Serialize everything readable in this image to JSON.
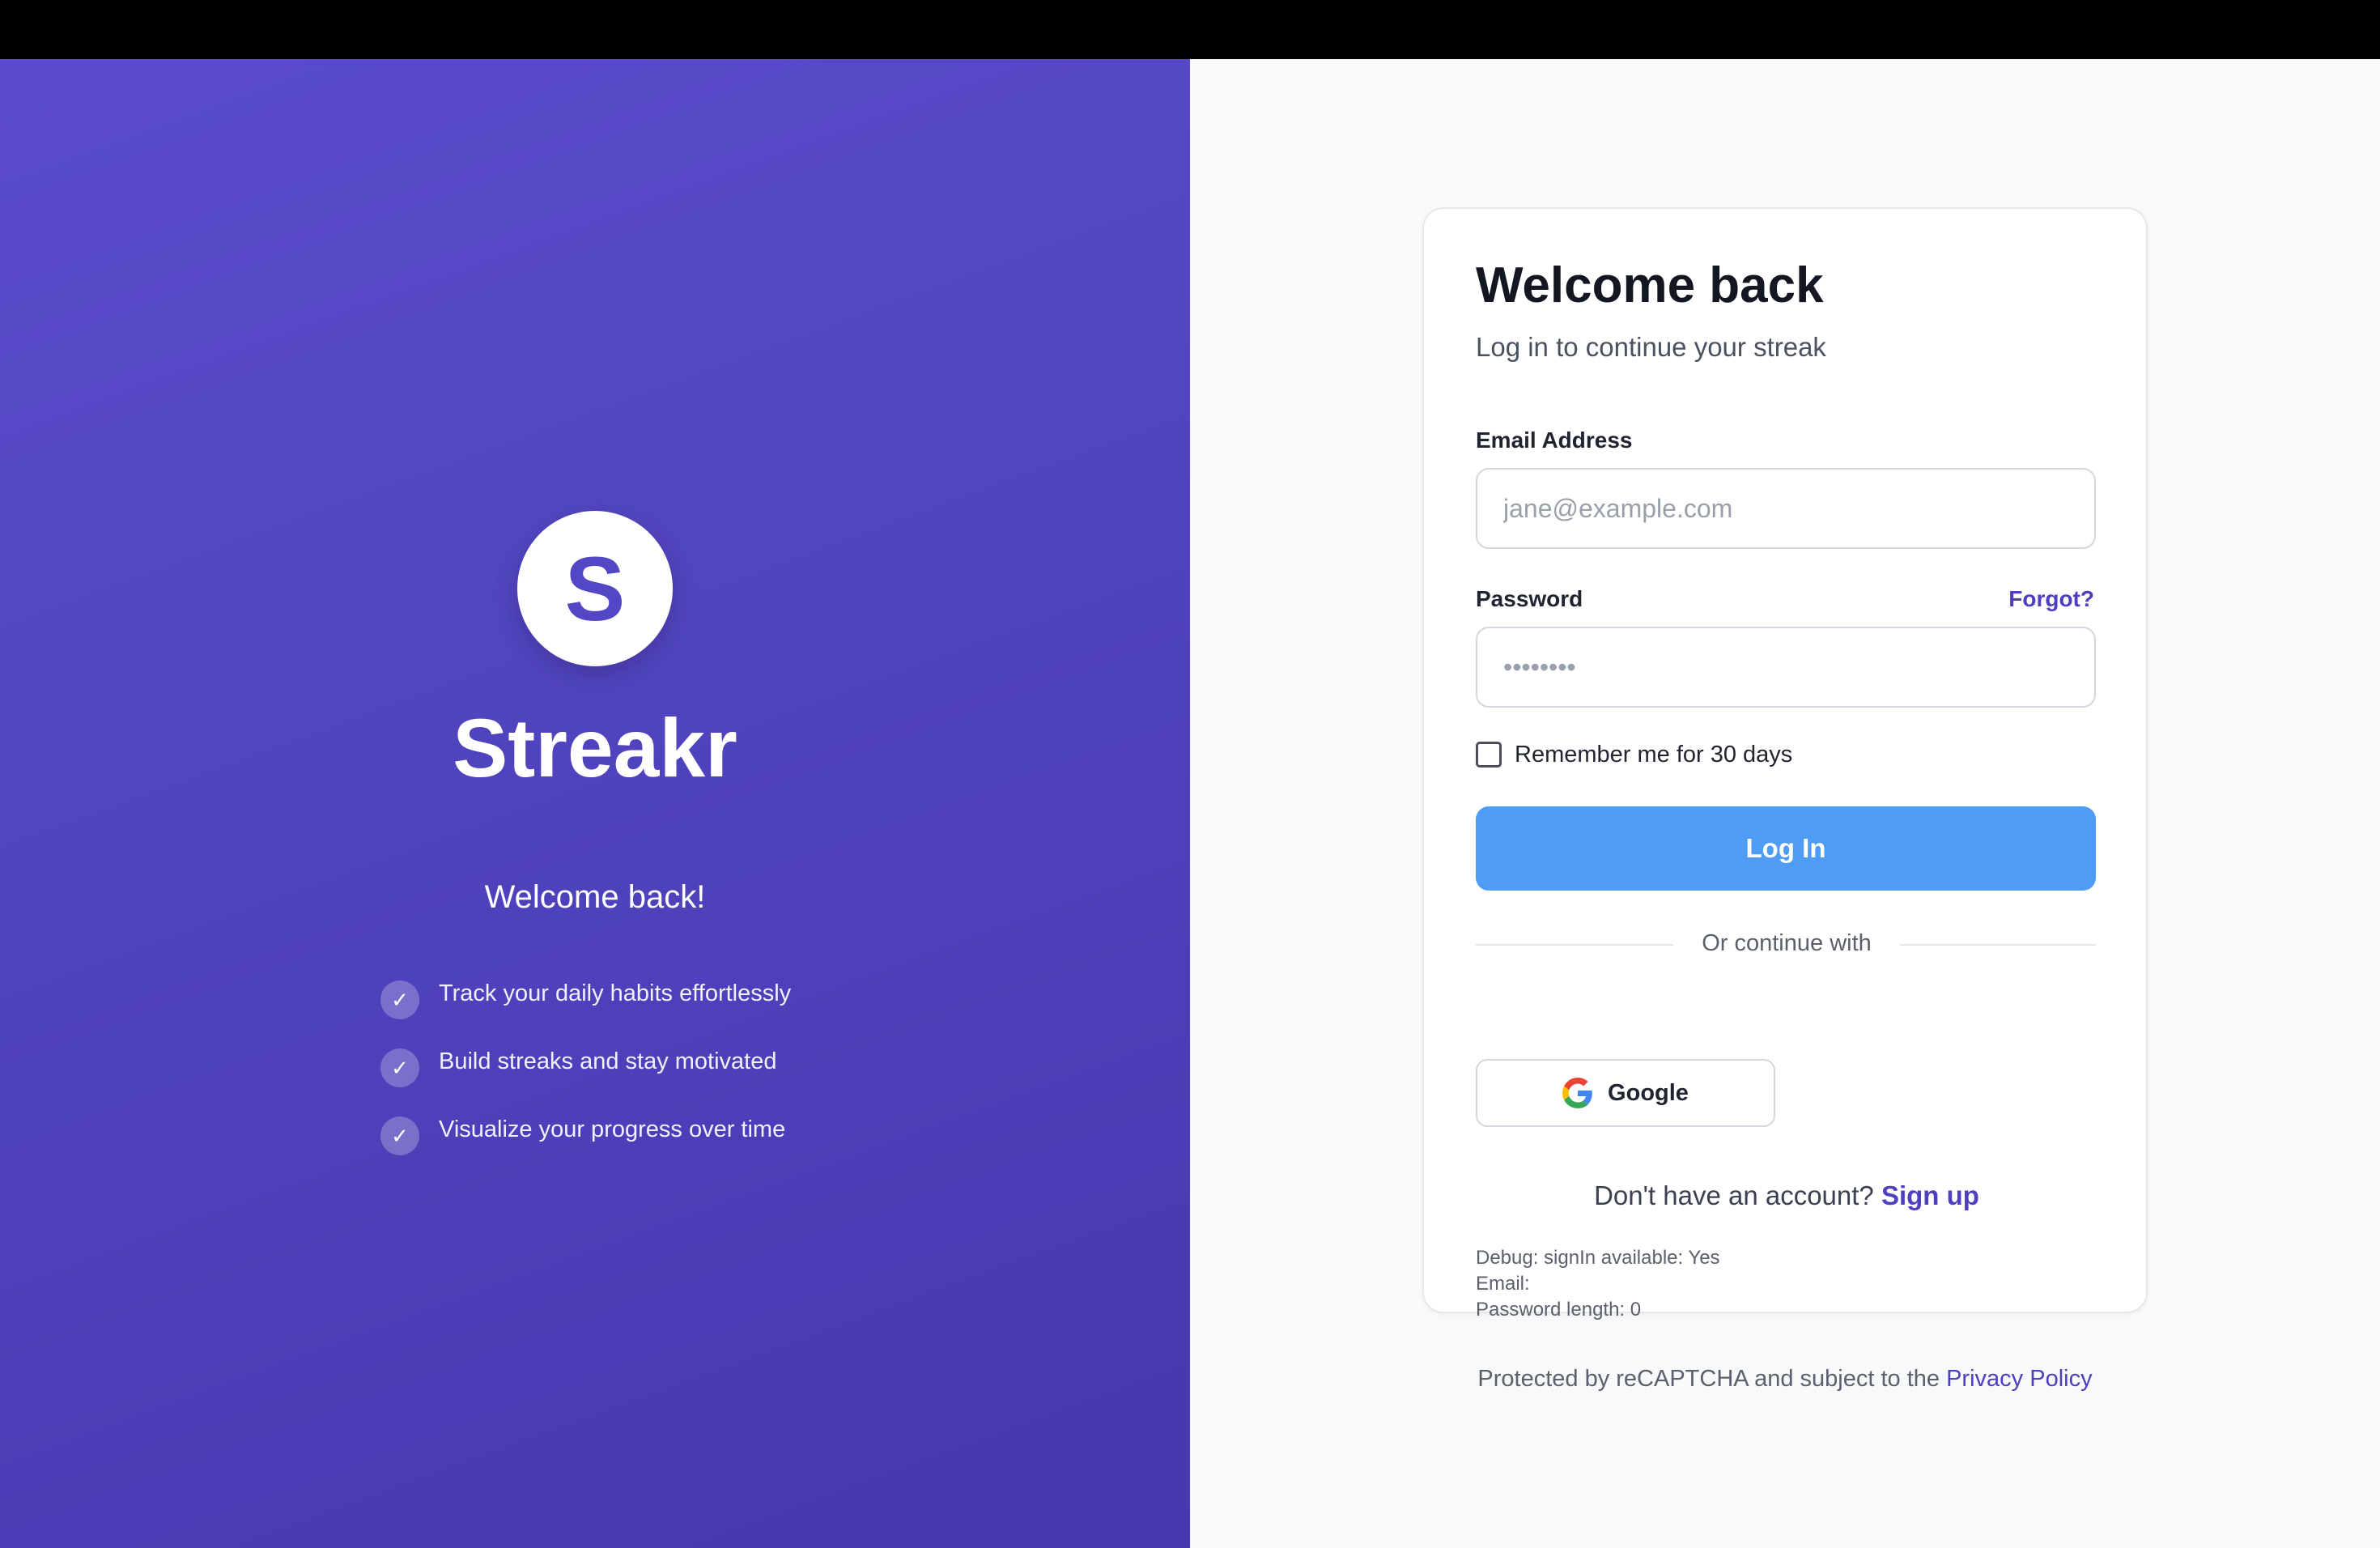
{
  "brand": {
    "logo_letter": "S",
    "name": "Streakr",
    "tagline": "Welcome back!",
    "features": [
      "Track your daily habits effortlessly",
      "Build streaks and stay motivated",
      "Visualize your progress over time"
    ],
    "check_glyph": "✓",
    "colors": {
      "panel_gradient_start": "#5a4ccb",
      "panel_gradient_end": "#4737b0"
    }
  },
  "form": {
    "title": "Welcome back",
    "subtitle": "Log in to continue your streak",
    "email": {
      "label": "Email Address",
      "placeholder": "jane@example.com",
      "value": ""
    },
    "password": {
      "label": "Password",
      "placeholder": "••••••••",
      "value": "",
      "forgot_label": "Forgot?"
    },
    "remember_label": "Remember me for 30 days",
    "remember_checked": false,
    "submit_label": "Log In",
    "divider_text": "Or continue with",
    "google_label": "Google",
    "google_icon": "google-g-icon",
    "signup_prompt": "Don't have an account?",
    "signup_link": "Sign up",
    "debug": {
      "line1": "Debug: signIn available: Yes",
      "line2": "Email:",
      "line3": "Password length: 0"
    },
    "colors": {
      "button": "#4f9cf7",
      "link": "#4d3fc0"
    }
  },
  "footer": {
    "text": "Protected by reCAPTCHA and subject to the",
    "link": "Privacy Policy"
  }
}
